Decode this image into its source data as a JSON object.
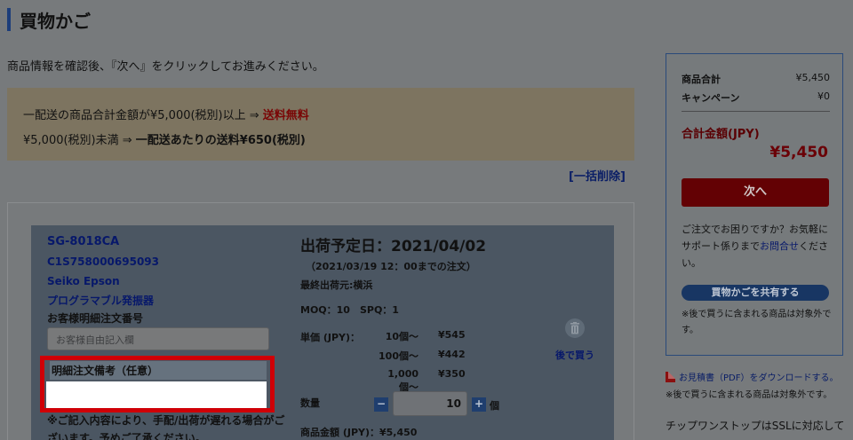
{
  "page": {
    "title": "買物かご",
    "intro": "商品情報を確認後、『次へ』をクリックしてお進みください。",
    "bulk_delete": "[一括削除]"
  },
  "shipping": {
    "line1_prefix": "一配送の商品合計金額が¥5,000(税別)以上 ⇒ ",
    "line1_free": "送料無料",
    "line2_prefix": "¥5,000(税別)未満 ⇒ ",
    "line2_fee": "一配送あたりの送料¥650(税別)"
  },
  "item": {
    "sku": "SG-8018CA",
    "part_code": "C1S758000695093",
    "maker": "Seiko Epson",
    "category": "プログラマブル発振器",
    "customer_order_label": "お客様明細注文番号",
    "customer_order_placeholder": "お客様自由記入欄",
    "memo_label": "明細注文備考（任意）",
    "memo_value": "",
    "memo_note": "※ご記入内容により、手配/出荷が遅れる場合がございます。予めご了承ください。",
    "ship_date": "出荷予定日：2021/04/02",
    "cutoff": "（2021/03/19 12：00までの注文）",
    "origin": "最終出荷元:横浜",
    "moq": "MOQ：10　SPQ：1",
    "unit_price_label": "単価 (JPY)：",
    "price_tiers": [
      {
        "qty": "10個〜",
        "price": "¥545"
      },
      {
        "qty": "100個〜",
        "price": "¥442"
      },
      {
        "qty": "1,000個〜",
        "price": "¥350"
      }
    ],
    "save_later": "後で買う",
    "qty_label": "数量",
    "qty_value": "10",
    "qty_unit": "個",
    "qty_minus": "−",
    "qty_plus": "+",
    "amount": "商品金額 (JPY)：¥5,450"
  },
  "summary": {
    "subtotal_label": "商品合計",
    "subtotal_value": "¥5,450",
    "campaign_label": "キャンペーン",
    "campaign_value": "¥0",
    "total_label": "合計金額(JPY)",
    "total_value": "¥5,450",
    "next_button": "次へ",
    "help_text": "ご注文でお困りですか？お気軽にサポート係りまで",
    "help_link": "お問合せ",
    "help_suffix": "ください。",
    "share_button": "買物かごを共有する",
    "share_note": "※後で買うに含まれる商品は対象外です。"
  },
  "footer_side": {
    "pdf_link": "お見積書（PDF）をダウンロードする。",
    "pdf_note": "※後で買うに含まれる商品は対象外です。",
    "ssl_note": "チップワンストップはSSLに対応して"
  },
  "colors": {
    "accent_navy": "#1c3d7a",
    "next_button": "#630104",
    "highlight_frame": "#cf0007"
  }
}
